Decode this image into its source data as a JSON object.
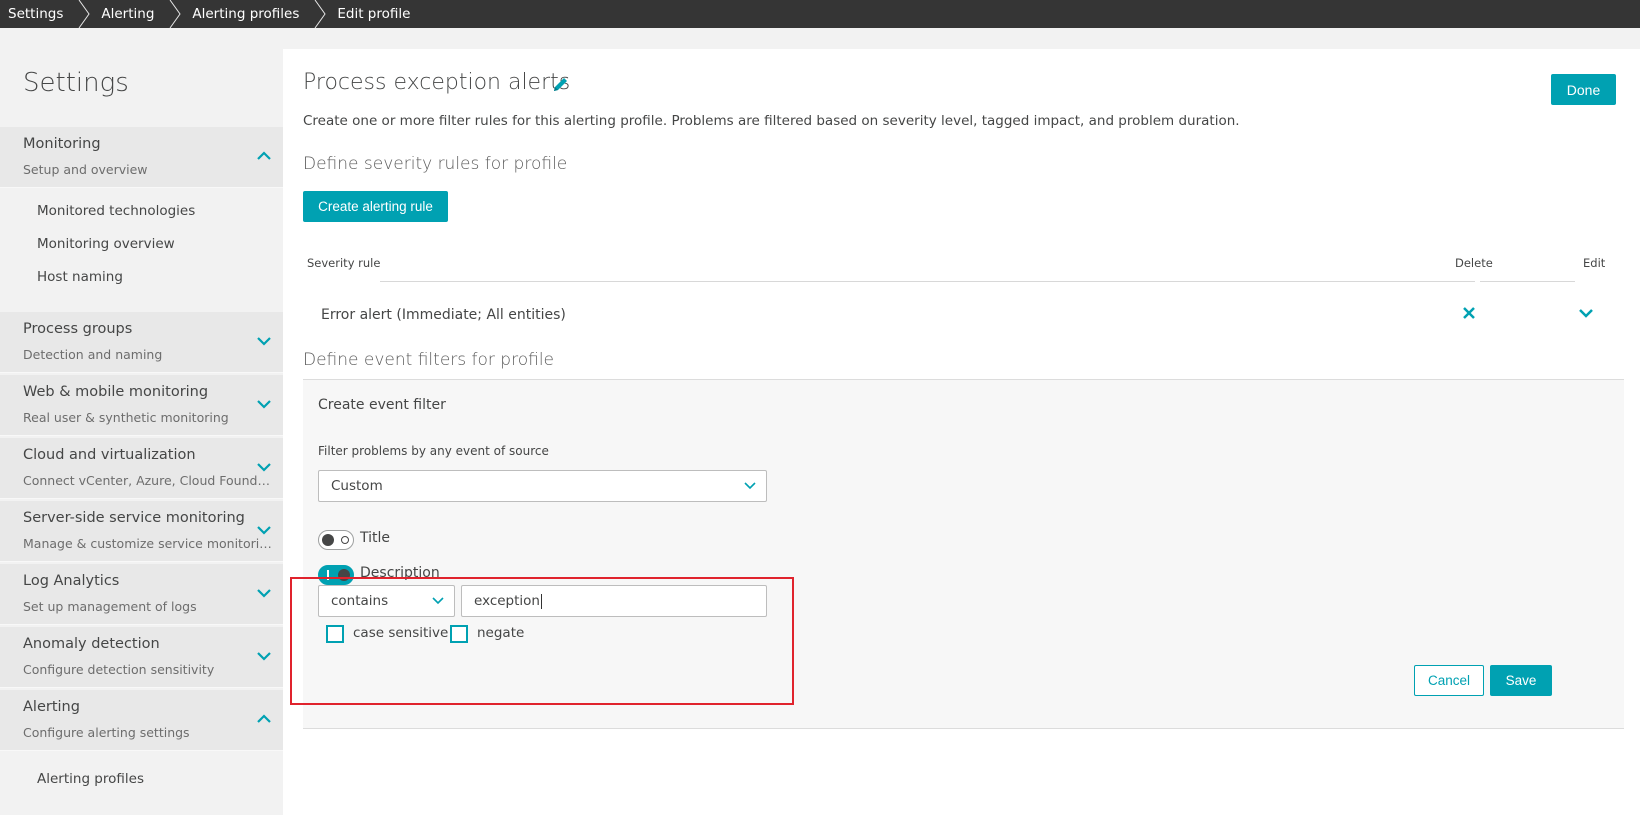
{
  "breadcrumb": [
    "Settings",
    "Alerting",
    "Alerting profiles",
    "Edit profile"
  ],
  "sidebar": {
    "title": "Settings",
    "sections": [
      {
        "name": "Monitoring",
        "sub": "Setup and overview",
        "expanded": true
      },
      {
        "name": "Process groups",
        "sub": "Detection and naming",
        "expanded": false
      },
      {
        "name": "Web & mobile monitoring",
        "sub": "Real user & synthetic monitoring",
        "expanded": false
      },
      {
        "name": "Cloud and virtualization",
        "sub": "Connect vCenter, Azure, Cloud Foundry o…",
        "expanded": false
      },
      {
        "name": "Server-side service monitoring",
        "sub": "Manage & customize service monitoring",
        "expanded": false
      },
      {
        "name": "Log Analytics",
        "sub": "Set up management of logs",
        "expanded": false
      },
      {
        "name": "Anomaly detection",
        "sub": "Configure detection sensitivity",
        "expanded": false
      },
      {
        "name": "Alerting",
        "sub": "Configure alerting settings",
        "expanded": true
      }
    ],
    "monitoring_items": [
      "Monitored technologies",
      "Monitoring overview",
      "Host naming"
    ],
    "alerting_items": [
      "Alerting profiles"
    ]
  },
  "main": {
    "title": "Process exception alerts",
    "done_label": "Done",
    "description": "Create one or more filter rules for this alerting profile. Problems are filtered based on severity level, tagged impact, and problem duration.",
    "severity_heading": "Define severity rules for profile",
    "create_rule_label": "Create alerting rule",
    "table": {
      "col_rule": "Severity rule",
      "col_delete": "Delete",
      "col_edit": "Edit",
      "rows": [
        "Error alert (Immediate; All entities)"
      ]
    },
    "event_heading": "Define event filters for profile",
    "filter": {
      "title": "Create event filter",
      "source_label": "Filter problems by any event of source",
      "source_value": "Custom",
      "title_toggle_label": "Title",
      "title_toggle_on": false,
      "description_toggle_label": "Description",
      "description_toggle_on": true,
      "operator_value": "contains",
      "text_value": "exception",
      "case_sensitive_label": "case sensitive",
      "negate_label": "negate",
      "cancel_label": "Cancel",
      "save_label": "Save"
    }
  },
  "colors": {
    "accent": "#00a1b2",
    "highlight": "#e0232d",
    "topbar": "#353535"
  }
}
